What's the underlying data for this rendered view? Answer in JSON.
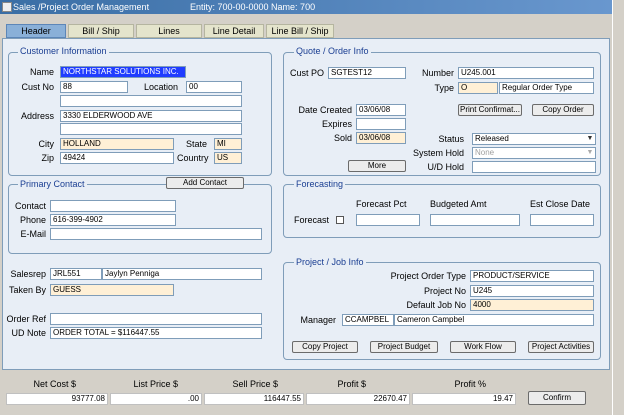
{
  "window": {
    "title": "Sales /Project Order Management",
    "entity": "Entity: 700-00-0000  Name: 700"
  },
  "tabs": [
    "Header",
    "Bill / Ship",
    "Lines",
    "Line Detail",
    "Line Bill / Ship"
  ],
  "customer": {
    "section": "Customer Information",
    "name_label": "Name",
    "name": "NORTHSTAR SOLUTIONS INC.",
    "custno_label": "Cust No",
    "custno": "88",
    "location_label": "Location",
    "location": "00",
    "address_label": "Address",
    "address_line1": "",
    "address_line2": "3330 ELDERWOOD AVE",
    "address_line3": "",
    "city_label": "City",
    "city": "HOLLAND",
    "state_label": "State",
    "state": "MI",
    "zip_label": "Zip",
    "zip": "49424",
    "country_label": "Country",
    "country": "US"
  },
  "contact": {
    "section": "Primary Contact",
    "add_button": "Add Contact",
    "contact_label": "Contact",
    "contact": "",
    "phone_label": "Phone",
    "phone": "616-399-4902",
    "email_label": "E-Mail",
    "email": ""
  },
  "sales": {
    "salesrep_label": "Salesrep",
    "salesrep_code": "JRL551",
    "salesrep_name": "Jaylyn Penniga",
    "takenby_label": "Taken By",
    "takenby": "GUESS",
    "orderref_label": "Order Ref",
    "orderref": "",
    "udnote_label": "UD Note",
    "udnote": "ORDER TOTAL = $116447.55"
  },
  "quote": {
    "section": "Quote / Order Info",
    "custpo_label": "Cust PO",
    "custpo": "SGTEST12",
    "number_label": "Number",
    "number": "U245.001",
    "type_label": "Type",
    "type_code": "O",
    "type_desc": "Regular Order Type",
    "datecreated_label": "Date Created",
    "datecreated": "03/06/08",
    "expires_label": "Expires",
    "expires": "",
    "sold_label": "Sold",
    "sold": "03/06/08",
    "print_button": "Print Confirmat...",
    "copy_button": "Copy Order",
    "status_label": "Status",
    "status": "Released",
    "systemhold_label": "System Hold",
    "systemhold": "None",
    "udhold_label": "U/D Hold",
    "udhold": "",
    "more_button": "More"
  },
  "forecasting": {
    "section": "Forecasting",
    "forecast_label": "Forecast",
    "pct_label": "Forecast Pct",
    "pct": "",
    "budget_label": "Budgeted Amt",
    "budget": "",
    "close_label": "Est Close Date",
    "close": ""
  },
  "project": {
    "section": "Project / Job Info",
    "ordertype_label": "Project Order Type",
    "ordertype": "PRODUCT/SERVICE",
    "projno_label": "Project No",
    "projno": "U245",
    "jobno_label": "Default Job No",
    "jobno": "4000",
    "manager_label": "Manager",
    "manager_code": "CCAMPBEL",
    "manager_name": "Cameron Campbel",
    "buttons": [
      "Copy Project",
      "Project Budget",
      "Work Flow",
      "Project Activities"
    ]
  },
  "totals": {
    "netcost_label": "Net Cost $",
    "netcost": "93777.08",
    "listprice_label": "List Price $",
    "listprice": ".00",
    "sellprice_label": "Sell Price $",
    "sellprice": "116447.55",
    "profit_label": "Profit $",
    "profit": "22670.47",
    "profitpct_label": "Profit %",
    "profitpct": "19.47",
    "confirm_button": "Confirm"
  }
}
